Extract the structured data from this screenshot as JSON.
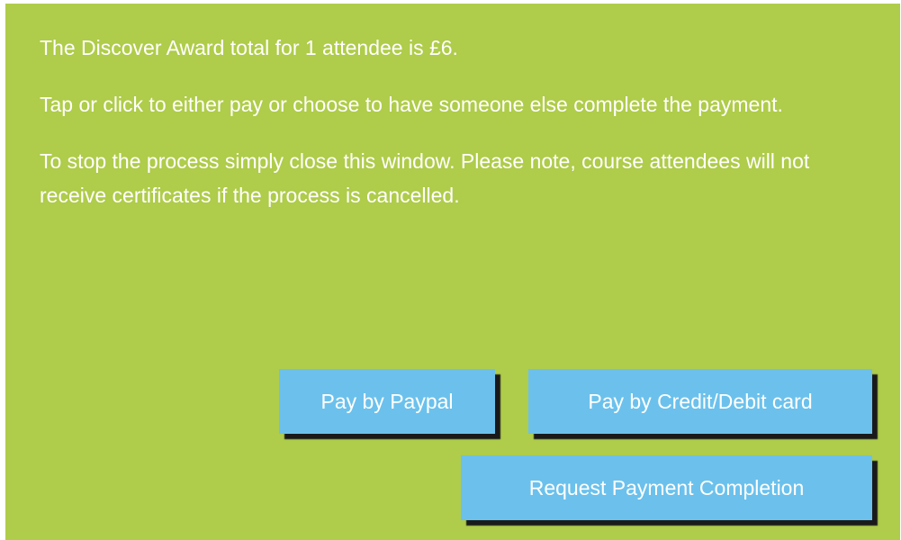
{
  "colors": {
    "panel_background": "#afcc4a",
    "button_background": "#6bc1ec",
    "text": "#ffffff"
  },
  "message": {
    "total_line": "The Discover Award total for 1 attendee is £6.",
    "instruction_line": "Tap or click to either pay or choose to have someone else complete the payment.",
    "cancel_note": "To stop the process simply close this window. Please note, course attendees will not receive certificates if the process is cancelled."
  },
  "buttons": {
    "paypal_label": "Pay by Paypal",
    "card_label": "Pay by Credit/Debit card",
    "request_label": "Request Payment Completion"
  }
}
